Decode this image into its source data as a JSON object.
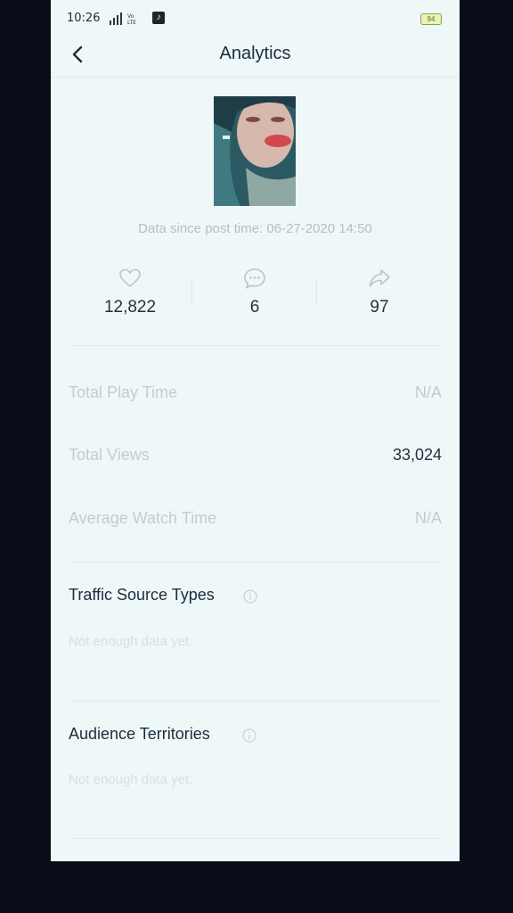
{
  "status_bar": {
    "time": "10:26",
    "battery": "94"
  },
  "header": {
    "title": "Analytics",
    "back_icon": "chevron-left-icon"
  },
  "post": {
    "data_since": "Data since post time: 06-27-2020 14:50"
  },
  "stats": [
    {
      "icon": "heart-icon",
      "value": "12,822"
    },
    {
      "icon": "comment-icon",
      "value": "6"
    },
    {
      "icon": "share-icon",
      "value": "97"
    }
  ],
  "metrics": [
    {
      "label": "Total Play Time",
      "value": "N/A"
    },
    {
      "label": "Total Views",
      "value": "33,024"
    },
    {
      "label": "Average Watch Time",
      "value": "N/A"
    }
  ],
  "sections": {
    "traffic": {
      "title": "Traffic Source Types",
      "empty": "Not enough data yet."
    },
    "audience": {
      "title": "Audience Territories",
      "empty": "Not enough data yet."
    }
  }
}
